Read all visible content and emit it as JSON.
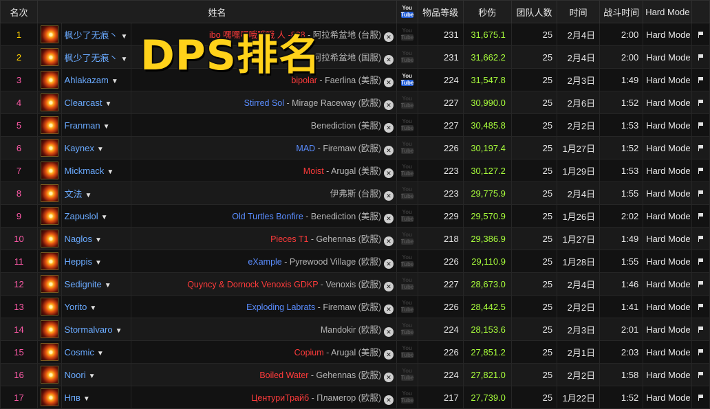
{
  "overlay_title": "DPS排名",
  "columns": {
    "rank": "名次",
    "name": "姓名",
    "youtube_top": "You",
    "youtube_bottom": "Tube",
    "item_level": "物品等级",
    "dps": "秒伤",
    "raid_size": "团队人数",
    "date": "时间",
    "duration": "战斗时间",
    "difficulty": "Hard Mode"
  },
  "rows": [
    {
      "rank": "1",
      "name": "枫少了无痕丶",
      "guild": "ibo 嘿嘿嘿哦哦哦 人 -838",
      "guild_color": "red",
      "realm": "阿拉希盆地 (台服)",
      "youtube": false,
      "ilvl": "231",
      "dps": "31,675.1",
      "size": "25",
      "date": "2月4日",
      "duration": "2:00",
      "difficulty": "Hard Mode"
    },
    {
      "rank": "2",
      "name": "枫少了无痕丶",
      "guild": "",
      "guild_color": "",
      "realm": "阿拉希盆地 (国服)",
      "youtube": false,
      "ilvl": "231",
      "dps": "31,662.2",
      "size": "25",
      "date": "2月4日",
      "duration": "2:00",
      "difficulty": "Hard Mode"
    },
    {
      "rank": "3",
      "name": "Ahlakazam",
      "guild": "bipolar",
      "guild_color": "red",
      "realm": "Faerlina (美服)",
      "youtube": true,
      "ilvl": "224",
      "dps": "31,547.8",
      "size": "25",
      "date": "2月3日",
      "duration": "1:49",
      "difficulty": "Hard Mode"
    },
    {
      "rank": "4",
      "name": "Clearcast",
      "guild": "Stirred Sol",
      "guild_color": "blue",
      "realm": "Mirage Raceway (欧服)",
      "youtube": false,
      "ilvl": "227",
      "dps": "30,990.0",
      "size": "25",
      "date": "2月6日",
      "duration": "1:52",
      "difficulty": "Hard Mode"
    },
    {
      "rank": "5",
      "name": "Franman",
      "guild": "",
      "guild_color": "",
      "realm": "Benediction (美服)",
      "youtube": false,
      "ilvl": "227",
      "dps": "30,485.8",
      "size": "25",
      "date": "2月2日",
      "duration": "1:53",
      "difficulty": "Hard Mode"
    },
    {
      "rank": "6",
      "name": "Kaynex",
      "guild": "MAD",
      "guild_color": "blue",
      "realm": "Firemaw (欧服)",
      "youtube": false,
      "ilvl": "226",
      "dps": "30,197.4",
      "size": "25",
      "date": "1月27日",
      "duration": "1:52",
      "difficulty": "Hard Mode"
    },
    {
      "rank": "7",
      "name": "Mickmack",
      "guild": "Moist",
      "guild_color": "red",
      "realm": "Arugal (美服)",
      "youtube": false,
      "ilvl": "223",
      "dps": "30,127.2",
      "size": "25",
      "date": "1月29日",
      "duration": "1:53",
      "difficulty": "Hard Mode"
    },
    {
      "rank": "8",
      "name": "文法",
      "guild": "",
      "guild_color": "",
      "realm": "伊弗斯 (台服)",
      "youtube": false,
      "ilvl": "223",
      "dps": "29,775.9",
      "size": "25",
      "date": "2月4日",
      "duration": "1:55",
      "difficulty": "Hard Mode"
    },
    {
      "rank": "9",
      "name": "Zapuslol",
      "guild": "Old Turtles Bonfire",
      "guild_color": "blue",
      "realm": "Benediction (美服)",
      "youtube": false,
      "ilvl": "229",
      "dps": "29,570.9",
      "size": "25",
      "date": "1月26日",
      "duration": "2:02",
      "difficulty": "Hard Mode"
    },
    {
      "rank": "10",
      "name": "Naglos",
      "guild": "Pieces T1",
      "guild_color": "red",
      "realm": "Gehennas (欧服)",
      "youtube": false,
      "ilvl": "218",
      "dps": "29,386.9",
      "size": "25",
      "date": "1月27日",
      "duration": "1:49",
      "difficulty": "Hard Mode"
    },
    {
      "rank": "11",
      "name": "Heppis",
      "guild": "eXample",
      "guild_color": "blue",
      "realm": "Pyrewood Village (欧服)",
      "youtube": false,
      "ilvl": "226",
      "dps": "29,110.9",
      "size": "25",
      "date": "1月28日",
      "duration": "1:55",
      "difficulty": "Hard Mode"
    },
    {
      "rank": "12",
      "name": "Sedignite",
      "guild": "Quyncy & Dornock Venoxis GDKP",
      "guild_color": "red",
      "realm": "Venoxis (欧服)",
      "youtube": false,
      "ilvl": "227",
      "dps": "28,673.0",
      "size": "25",
      "date": "2月4日",
      "duration": "1:46",
      "difficulty": "Hard Mode"
    },
    {
      "rank": "13",
      "name": "Yorito",
      "guild": "Exploding Labrats",
      "guild_color": "blue",
      "realm": "Firemaw (欧服)",
      "youtube": false,
      "ilvl": "226",
      "dps": "28,442.5",
      "size": "25",
      "date": "2月2日",
      "duration": "1:41",
      "difficulty": "Hard Mode"
    },
    {
      "rank": "14",
      "name": "Stormalvaro",
      "guild": "",
      "guild_color": "",
      "realm": "Mandokir (欧服)",
      "youtube": false,
      "ilvl": "224",
      "dps": "28,153.6",
      "size": "25",
      "date": "2月3日",
      "duration": "2:01",
      "difficulty": "Hard Mode"
    },
    {
      "rank": "15",
      "name": "Cosmic",
      "guild": "Copium",
      "guild_color": "red",
      "realm": "Arugal (美服)",
      "youtube": false,
      "ilvl": "226",
      "dps": "27,851.2",
      "size": "25",
      "date": "2月1日",
      "duration": "2:03",
      "difficulty": "Hard Mode"
    },
    {
      "rank": "16",
      "name": "Noori",
      "guild": "Boiled Water",
      "guild_color": "red",
      "realm": "Gehennas (欧服)",
      "youtube": false,
      "ilvl": "224",
      "dps": "27,821.0",
      "size": "25",
      "date": "2月2日",
      "duration": "1:58",
      "difficulty": "Hard Mode"
    },
    {
      "rank": "17",
      "name": "Нпв",
      "guild": "ЦентуриТрайб",
      "guild_color": "red",
      "realm": "Пламегор (欧服)",
      "youtube": false,
      "ilvl": "217",
      "dps": "27,739.0",
      "size": "25",
      "date": "1月22日",
      "duration": "1:52",
      "difficulty": "Hard Mode"
    }
  ]
}
